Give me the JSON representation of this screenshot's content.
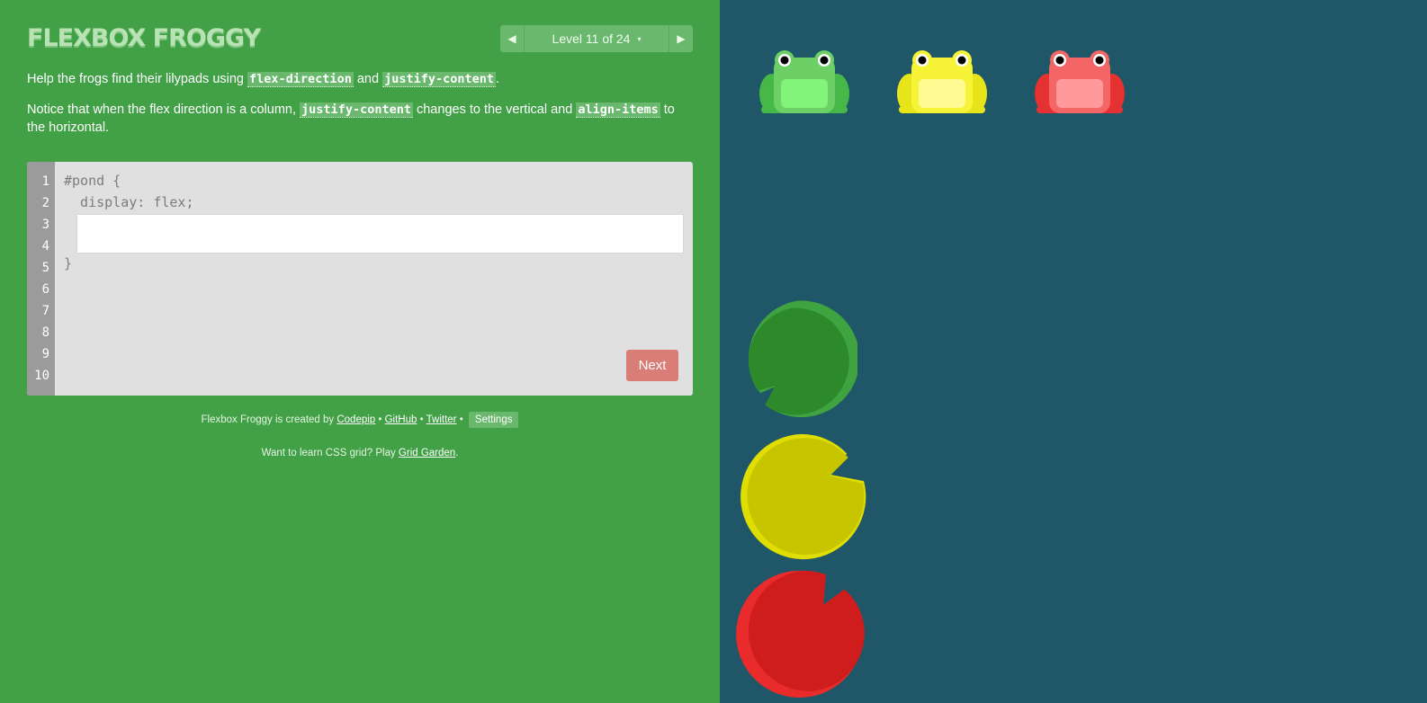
{
  "header": {
    "title": "FLEXBOX FROGGY"
  },
  "level_nav": {
    "prev_icon": "triangle-left-icon",
    "label": "Level 11 of 24",
    "caret": "▾",
    "next_icon": "triangle-right-icon"
  },
  "instructions": {
    "p1": {
      "text1": "Help the frogs find their lilypads using ",
      "code1": "flex-direction",
      "text2": " and ",
      "code2": "justify-content",
      "text3": "."
    },
    "p2": {
      "text1": "Notice that when the flex direction is a column, ",
      "code1": "justify-content",
      "text2": " changes to the vertical and ",
      "code2": "align-items",
      "text3": " to the horizontal."
    }
  },
  "editor": {
    "line_numbers": [
      "1",
      "2",
      "3",
      "4",
      "5",
      "6",
      "7",
      "8",
      "9",
      "10"
    ],
    "line1": "#pond {",
    "line2": "  display: flex;",
    "line5": "}",
    "input_value": "",
    "next_label": "Next"
  },
  "credits": {
    "prefix": "Flexbox Froggy is created by ",
    "codepip": "Codepip",
    "sep1": " • ",
    "github": "GitHub",
    "sep2": " • ",
    "twitter": "Twitter",
    "sep3": " • ",
    "settings": "Settings"
  },
  "promo": {
    "prefix": "Want to learn CSS grid? Play ",
    "link": "Grid Garden",
    "suffix": "."
  },
  "colors": {
    "sidebar_bg": "#42a047",
    "pond_bg": "#1f5768",
    "frog_green": "#6cd067",
    "frog_yellow": "#f3ef2f",
    "frog_red": "#f15d5d",
    "pad_green": "#2c8a2b",
    "pad_yellow": "#c6c500",
    "pad_red": "#cf1c1c"
  }
}
